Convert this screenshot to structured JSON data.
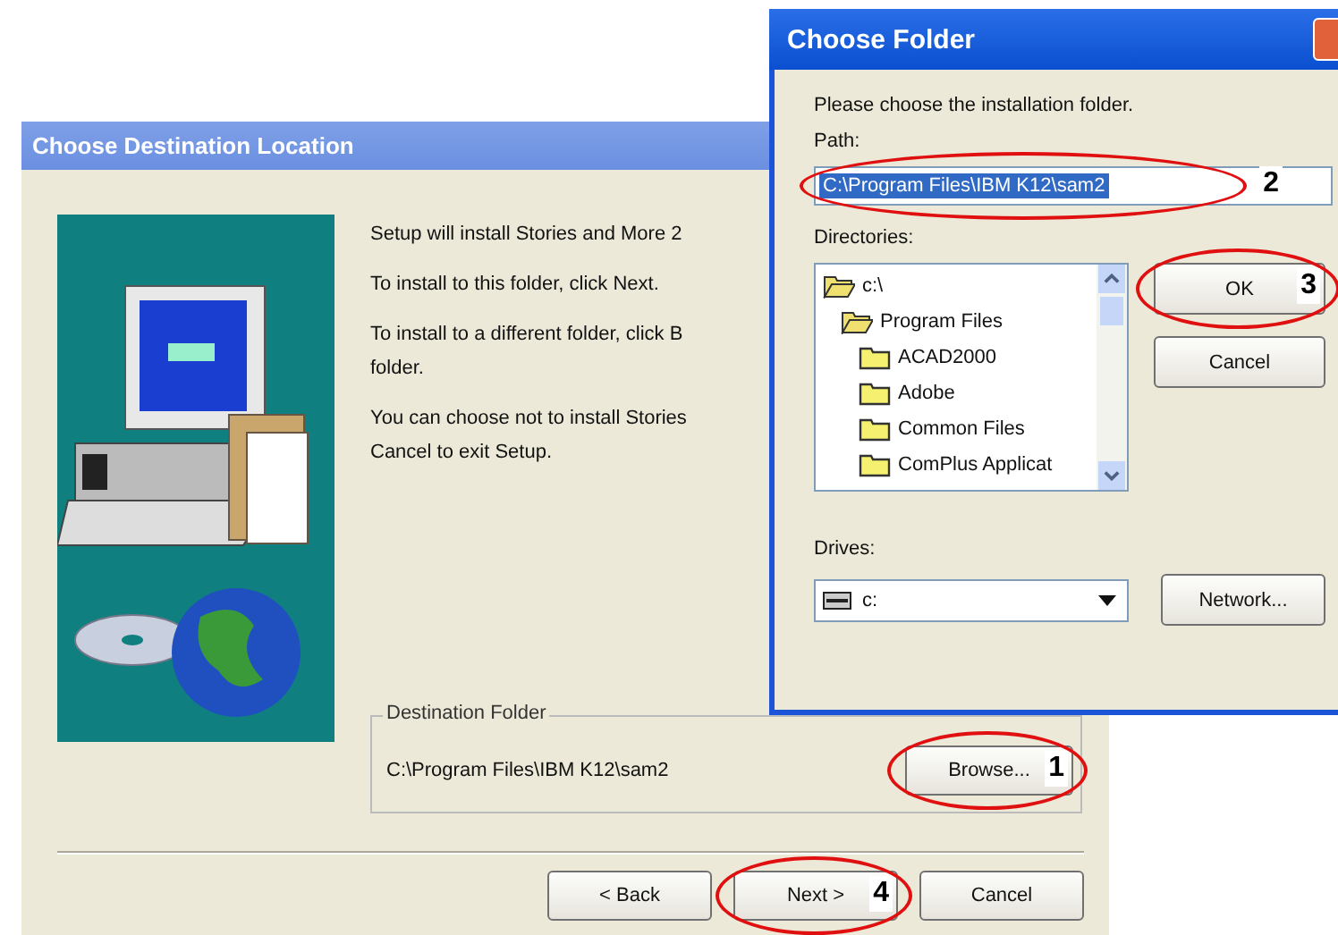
{
  "setup_dialog": {
    "title": "Choose Destination Location",
    "paragraphs": [
      [
        "Setup will install Stories and More 2"
      ],
      [
        "To install to this folder, click Next."
      ],
      [
        "To install to a different folder, click B",
        "folder."
      ],
      [
        "You can choose not to install Stories",
        "Cancel to exit Setup."
      ]
    ],
    "destination_folder": {
      "label": "Destination Folder",
      "path": "C:\\Program Files\\IBM K12\\sam2",
      "browse_button": {
        "label": "Browse...",
        "annotation": "1"
      }
    },
    "buttons": [
      {
        "label": "< Back"
      },
      {
        "label": "Next >",
        "annotation": "4"
      },
      {
        "label": "Cancel"
      }
    ]
  },
  "folder_dialog": {
    "title": "Choose Folder",
    "prompt": "Please choose the installation folder.",
    "path": {
      "label": "Path:",
      "value": "C:\\Program Files\\IBM K12\\sam2",
      "text_selected": true,
      "annotation": "2"
    },
    "directories": {
      "label": "Directories:",
      "items": [
        {
          "name": "c:\\",
          "expanded": true,
          "children": [
            {
              "name": "Program Files",
              "expanded": true,
              "children": [
                {
                  "name": "ACAD2000",
                  "expanded": false
                },
                {
                  "name": "Adobe",
                  "expanded": false
                },
                {
                  "name": "Common Files",
                  "expanded": false
                },
                {
                  "name": "ComPlus Applicat",
                  "expanded": false
                }
              ]
            }
          ]
        }
      ]
    },
    "buttons": [
      {
        "label": "OK",
        "annotation": "3"
      },
      {
        "label": "Cancel"
      }
    ],
    "drives": {
      "label": "Drives:",
      "value": "c:"
    },
    "network_button": {
      "label": "Network..."
    }
  }
}
